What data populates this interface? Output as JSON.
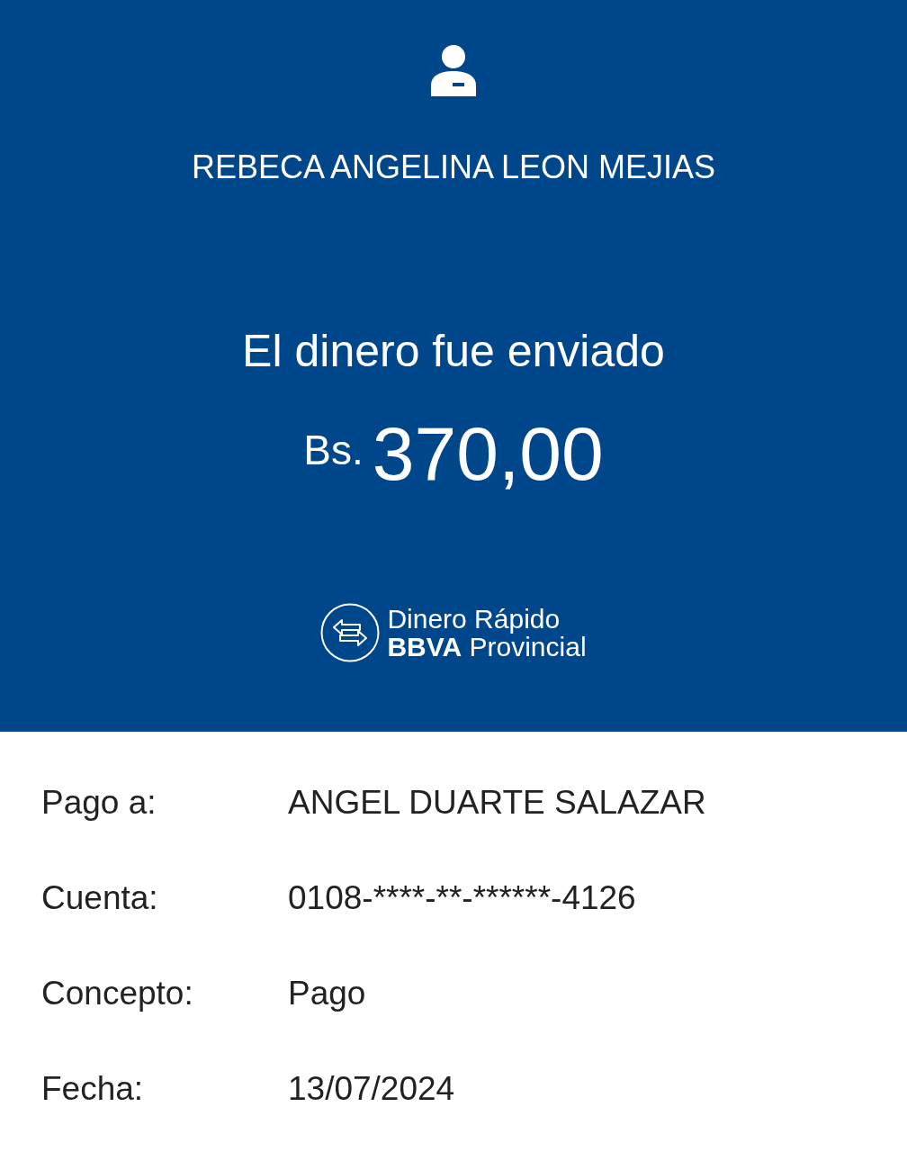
{
  "header": {
    "recipient": "REBECA ANGELINA LEON MEJIAS",
    "message": "El dinero fue enviado",
    "currency": "Bs.",
    "amount": "370,00"
  },
  "brand": {
    "line_1": "Dinero Rápido",
    "line_2": "**BBVA** Provincial"
  },
  "details": [
    {
      "label": "Pago a:",
      "value": "ANGEL DUARTE SALAZAR"
    },
    {
      "label": "Cuenta:",
      "value": "0108-****-**-******-4126"
    },
    {
      "label": "Concepto:",
      "value": "Pago"
    },
    {
      "label": "Fecha:",
      "value": "13/07/2024"
    }
  ]
}
